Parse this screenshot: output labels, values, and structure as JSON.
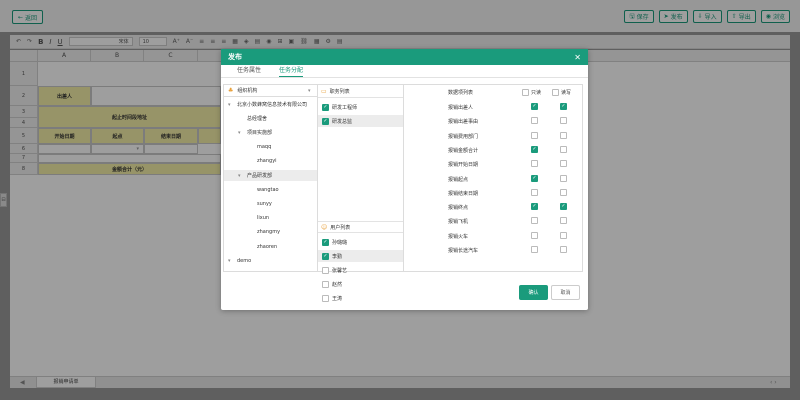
{
  "page": {
    "back_label": "返回",
    "actions": [
      {
        "label": "保存",
        "icon": "save-icon",
        "glyph": "🖫"
      },
      {
        "label": "发布",
        "icon": "send-icon",
        "glyph": "➤"
      },
      {
        "label": "导入",
        "icon": "import-icon",
        "glyph": "⇩"
      },
      {
        "label": "导出",
        "icon": "export-icon",
        "glyph": "⇧"
      },
      {
        "label": "浏览",
        "icon": "eye-icon",
        "glyph": "◉"
      }
    ]
  },
  "toolbar": {
    "font": "宋体",
    "size": "10"
  },
  "sheet": {
    "columns": [
      "A",
      "B",
      "C"
    ],
    "rows": [
      "1",
      "2",
      "3",
      "4",
      "5",
      "6",
      "7",
      "8"
    ],
    "cells": {
      "applicant": "出差人",
      "route": "起止时间段地址",
      "start_date": "开始日期",
      "start_point": "起点",
      "end_date": "结束日期",
      "total": "金额合计（元）"
    },
    "tab_name": "报销申请单"
  },
  "modal": {
    "title": "发布",
    "tabs": [
      "任务属性",
      "任务分配"
    ],
    "active_tab": 1,
    "org": {
      "selector_label": "组织机构",
      "tree": [
        {
          "label": "北京小数蜂窝信息技术有限公司",
          "level": 0,
          "caret": "▾"
        },
        {
          "label": "总经理舍",
          "level": 1,
          "caret": ""
        },
        {
          "label": "项目实施部",
          "level": 1,
          "caret": "▾"
        },
        {
          "label": "maqq",
          "level": 2,
          "caret": ""
        },
        {
          "label": "zhangyi",
          "level": 2,
          "caret": ""
        },
        {
          "label": "产品研发部",
          "level": 1,
          "caret": "▾",
          "selected": true
        },
        {
          "label": "wangtao",
          "level": 2,
          "caret": ""
        },
        {
          "label": "sunyy",
          "level": 2,
          "caret": ""
        },
        {
          "label": "lixun",
          "level": 2,
          "caret": ""
        },
        {
          "label": "zhangmy",
          "level": 2,
          "caret": ""
        },
        {
          "label": "zhaoren",
          "level": 2,
          "caret": ""
        },
        {
          "label": "demo",
          "level": 0,
          "caret": "▾"
        }
      ]
    },
    "roles": {
      "title": "职务列表",
      "items": [
        {
          "label": "研发工程师",
          "checked": true
        },
        {
          "label": "研发总监",
          "checked": true,
          "selected": true
        }
      ]
    },
    "users": {
      "title": "用户列表",
      "items": [
        {
          "label": "孙璐璐",
          "checked": true
        },
        {
          "label": "李勤",
          "checked": true,
          "selected": true
        },
        {
          "label": "张馨艺",
          "checked": false
        },
        {
          "label": "赵然",
          "checked": false
        },
        {
          "label": "王涛",
          "checked": false
        }
      ]
    },
    "data_items": {
      "header": "数据项列表",
      "col_read": "只读",
      "col_write": "读写",
      "rows": [
        {
          "label": "报销出差人",
          "read": true,
          "write": true
        },
        {
          "label": "报销出差事由",
          "read": false,
          "write": false
        },
        {
          "label": "报销费用部门",
          "read": false,
          "write": false
        },
        {
          "label": "报销金额合计",
          "read": true,
          "write": false
        },
        {
          "label": "报销开始日期",
          "read": false,
          "write": false
        },
        {
          "label": "报销起点",
          "read": true,
          "write": false
        },
        {
          "label": "报销结束日期",
          "read": false,
          "write": false
        },
        {
          "label": "报销终点",
          "read": true,
          "write": true
        },
        {
          "label": "报销飞机",
          "read": false,
          "write": false
        },
        {
          "label": "报销火车",
          "read": false,
          "write": false
        },
        {
          "label": "报销长途汽车",
          "read": false,
          "write": false
        }
      ]
    },
    "confirm_label": "确认",
    "cancel_label": "取消"
  },
  "colors": {
    "accent": "#1a9b7c",
    "cell_fill": "#f4efa8"
  }
}
